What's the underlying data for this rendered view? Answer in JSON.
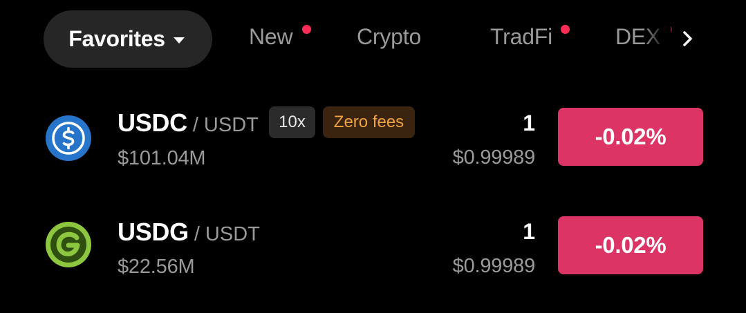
{
  "tabs": {
    "active": {
      "label": "Favorites",
      "icon": "caret-down-icon"
    },
    "items": [
      {
        "label": "New",
        "has_dot": true
      },
      {
        "label": "Crypto",
        "has_dot": false
      },
      {
        "label": "TradFi",
        "has_dot": true
      },
      {
        "label": "DEX",
        "has_dot": true
      }
    ],
    "more_icon": "chevron-right-icon"
  },
  "rows": [
    {
      "base": "USDC",
      "quote": "/ USDT",
      "icon": "usdc-coin-icon",
      "leverage": "10x",
      "fee_badge": "Zero fees",
      "volume": "$101.04M",
      "last_price": "1",
      "price_usd": "$0.99989",
      "change": "-0.02%"
    },
    {
      "base": "USDG",
      "quote": "/ USDT",
      "icon": "usdg-coin-icon",
      "volume": "$22.56M",
      "last_price": "1",
      "price_usd": "$0.99989",
      "change": "-0.02%"
    }
  ],
  "colors": {
    "background": "#000000",
    "pill": "#262626",
    "muted_text": "#9a9a9a",
    "negative": "#dc3565",
    "notification_dot": "#ff2d55",
    "fee_badge_bg": "#3a2410",
    "fee_badge_text": "#f0a33c",
    "usdc_blue": "#2775ca",
    "usdg_green": "#8dc63f"
  }
}
